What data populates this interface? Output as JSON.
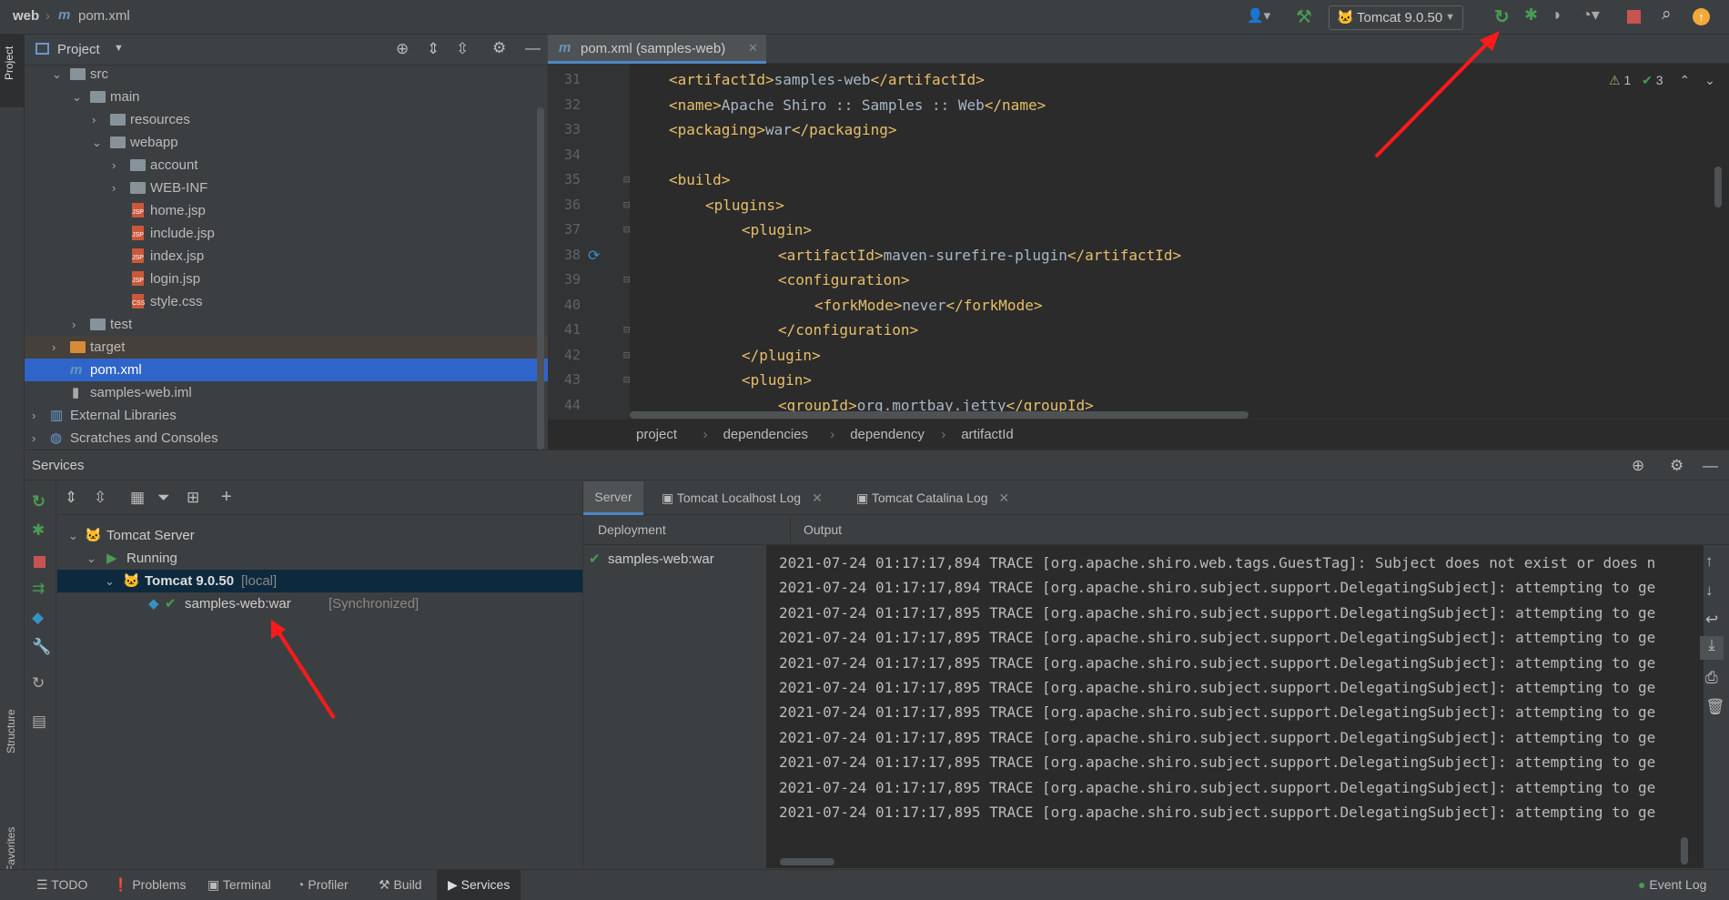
{
  "titlebar": {
    "crumbs": [
      "web",
      "pom.xml"
    ],
    "run_config": "Tomcat 9.0.50"
  },
  "colors": {
    "accent_green": "#499c54",
    "stop_red": "#c75450",
    "selection": "#2f65ca",
    "tag": "#e8bf6a",
    "text": "#a9b7c6"
  },
  "left_stripe": {
    "project": "Project",
    "structure": "Structure",
    "favorites": "Favorites"
  },
  "project": {
    "title": "Project",
    "tree": [
      {
        "label": "src",
        "depth": 1,
        "type": "folder",
        "open": true
      },
      {
        "label": "main",
        "depth": 2,
        "type": "folder",
        "open": true
      },
      {
        "label": "resources",
        "depth": 3,
        "type": "folder",
        "open": false
      },
      {
        "label": "webapp",
        "depth": 3,
        "type": "folder",
        "open": true
      },
      {
        "label": "account",
        "depth": 4,
        "type": "folder",
        "open": false
      },
      {
        "label": "WEB-INF",
        "depth": 4,
        "type": "folder",
        "open": false
      },
      {
        "label": "home.jsp",
        "depth": 4,
        "type": "jsp"
      },
      {
        "label": "include.jsp",
        "depth": 4,
        "type": "jsp"
      },
      {
        "label": "index.jsp",
        "depth": 4,
        "type": "jsp"
      },
      {
        "label": "login.jsp",
        "depth": 4,
        "type": "jsp"
      },
      {
        "label": "style.css",
        "depth": 4,
        "type": "css"
      },
      {
        "label": "test",
        "depth": 2,
        "type": "folder",
        "open": false
      },
      {
        "label": "target",
        "depth": 1,
        "type": "target",
        "open": false
      },
      {
        "label": "pom.xml",
        "depth": 1,
        "type": "maven",
        "selected": true
      },
      {
        "label": "samples-web.iml",
        "depth": 1,
        "type": "iml"
      },
      {
        "label": "External Libraries",
        "depth": 0,
        "type": "lib",
        "open": false
      },
      {
        "label": "Scratches and Consoles",
        "depth": 0,
        "type": "scratch",
        "open": false
      }
    ]
  },
  "editor": {
    "tab": "pom.xml (samples-web)",
    "warnings": "1",
    "checks": "3",
    "lines": [
      {
        "n": "31",
        "indent": 1,
        "code": [
          [
            "t",
            "<artifactId>"
          ],
          [
            "x",
            "samples-web"
          ],
          [
            "t",
            "</artifactId>"
          ]
        ]
      },
      {
        "n": "32",
        "indent": 1,
        "code": [
          [
            "t",
            "<name>"
          ],
          [
            "x",
            "Apache Shiro :: Samples :: Web"
          ],
          [
            "t",
            "</name>"
          ]
        ]
      },
      {
        "n": "33",
        "indent": 1,
        "code": [
          [
            "t",
            "<packaging>"
          ],
          [
            "x",
            "war"
          ],
          [
            "t",
            "</packaging>"
          ]
        ]
      },
      {
        "n": "34",
        "indent": 1,
        "code": []
      },
      {
        "n": "35",
        "indent": 1,
        "code": [
          [
            "t",
            "<build>"
          ]
        ]
      },
      {
        "n": "36",
        "indent": 2,
        "code": [
          [
            "t",
            "<plugins>"
          ]
        ]
      },
      {
        "n": "37",
        "indent": 3,
        "code": [
          [
            "t",
            "<plugin>"
          ]
        ]
      },
      {
        "n": "38",
        "indent": 4,
        "code": [
          [
            "t",
            "<artifactId>"
          ],
          [
            "x",
            "maven-surefire-plugin"
          ],
          [
            "t",
            "</artifactId>"
          ]
        ]
      },
      {
        "n": "39",
        "indent": 4,
        "code": [
          [
            "t",
            "<configuration>"
          ]
        ]
      },
      {
        "n": "40",
        "indent": 5,
        "code": [
          [
            "t",
            "<forkMode>"
          ],
          [
            "x",
            "never"
          ],
          [
            "t",
            "</forkMode>"
          ]
        ]
      },
      {
        "n": "41",
        "indent": 4,
        "code": [
          [
            "t",
            "</configuration>"
          ]
        ]
      },
      {
        "n": "42",
        "indent": 3,
        "code": [
          [
            "t",
            "</plugin>"
          ]
        ]
      },
      {
        "n": "43",
        "indent": 3,
        "code": [
          [
            "t",
            "<plugin>"
          ]
        ]
      },
      {
        "n": "44",
        "indent": 4,
        "code": [
          [
            "t",
            "<groupId>"
          ],
          [
            "x",
            "org.mortbay.jetty"
          ],
          [
            "t",
            "</groupId>"
          ]
        ]
      }
    ],
    "breadcrumb": [
      "project",
      "dependencies",
      "dependency",
      "artifactId"
    ]
  },
  "services": {
    "title": "Services",
    "tree": [
      {
        "label": "Tomcat Server",
        "extra": ""
      },
      {
        "label": "Running",
        "extra": ""
      },
      {
        "label": "Tomcat 9.0.50",
        "extra": "[local]"
      },
      {
        "label": "samples-web:war",
        "extra": "[Synchronized]"
      }
    ],
    "tabs": [
      "Server",
      "Tomcat Localhost Log",
      "Tomcat Catalina Log"
    ],
    "deployment_header": "Deployment",
    "output_header": "Output",
    "deployment": "samples-web:war",
    "log": [
      "2021-07-24 01:17:17,894 TRACE [org.apache.shiro.web.tags.GuestTag]: Subject does not exist or does n",
      "2021-07-24 01:17:17,894 TRACE [org.apache.shiro.subject.support.DelegatingSubject]: attempting to ge",
      "2021-07-24 01:17:17,895 TRACE [org.apache.shiro.subject.support.DelegatingSubject]: attempting to ge",
      "2021-07-24 01:17:17,895 TRACE [org.apache.shiro.subject.support.DelegatingSubject]: attempting to ge",
      "2021-07-24 01:17:17,895 TRACE [org.apache.shiro.subject.support.DelegatingSubject]: attempting to ge",
      "2021-07-24 01:17:17,895 TRACE [org.apache.shiro.subject.support.DelegatingSubject]: attempting to ge",
      "2021-07-24 01:17:17,895 TRACE [org.apache.shiro.subject.support.DelegatingSubject]: attempting to ge",
      "2021-07-24 01:17:17,895 TRACE [org.apache.shiro.subject.support.DelegatingSubject]: attempting to ge",
      "2021-07-24 01:17:17,895 TRACE [org.apache.shiro.subject.support.DelegatingSubject]: attempting to ge",
      "2021-07-24 01:17:17,895 TRACE [org.apache.shiro.subject.support.DelegatingSubject]: attempting to ge",
      "2021-07-24 01:17:17,895 TRACE [org.apache.shiro.subject.support.DelegatingSubject]: attempting to ge"
    ]
  },
  "bottombar": {
    "items": [
      "TODO",
      "Problems",
      "Terminal",
      "Profiler",
      "Build",
      "Services"
    ],
    "event_log": "Event Log"
  }
}
